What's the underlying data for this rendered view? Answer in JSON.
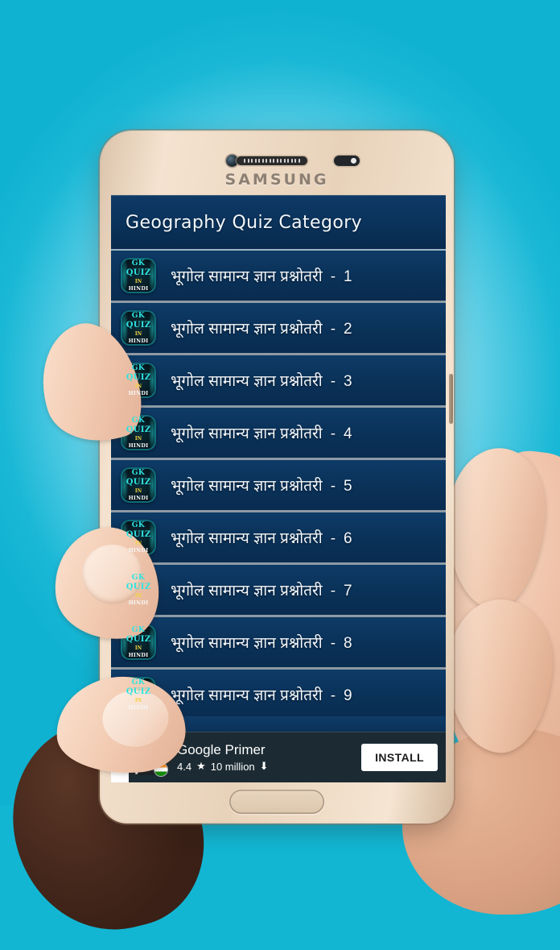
{
  "background": {
    "accent_cyan": "#12b6d3",
    "center_light": "#ddf7fb"
  },
  "device": {
    "brand": "SAMSUNG",
    "bezel_color": "#e8d2ba",
    "hardware": {
      "camera": "front-camera",
      "speaker": "earpiece-speaker",
      "sensor": "proximity-sensor",
      "power_button": "power-button",
      "home_button": "home-button"
    }
  },
  "app": {
    "appbar": {
      "title": "Geography Quiz Category",
      "background": "#0a3159",
      "text_color": "#f2f7fb"
    },
    "icon": {
      "line1": "GK",
      "line2": "QUIZ",
      "line3": "IN",
      "line4": "HINDI",
      "teal": "#2fe3e0",
      "yellow": "#f4d23c"
    },
    "list": {
      "row_background": "#0a3158",
      "separator_color": "#c7d0d7",
      "items": [
        {
          "label": "भूगोल सामान्य ज्ञान प्रश्नोतरी",
          "dash": "-",
          "number": "1"
        },
        {
          "label": "भूगोल सामान्य ज्ञान प्रश्नोतरी",
          "dash": "-",
          "number": "2"
        },
        {
          "label": "भूगोल सामान्य ज्ञान प्रश्नोतरी",
          "dash": "-",
          "number": "3"
        },
        {
          "label": "भूगोल सामान्य ज्ञान प्रश्नोतरी",
          "dash": "-",
          "number": "4"
        },
        {
          "label": "भूगोल सामान्य ज्ञान प्रश्नोतरी",
          "dash": "-",
          "number": "5"
        },
        {
          "label": "भूगोल सामान्य ज्ञान प्रश्नोतरी",
          "dash": "-",
          "number": "6"
        },
        {
          "label": "भूगोल सामान्य ज्ञान प्रश्नोतरी",
          "dash": "-",
          "number": "7"
        },
        {
          "label": "भूगोल सामान्य ज्ञान प्रश्नोतरी",
          "dash": "-",
          "number": "8"
        },
        {
          "label": "भूगोल सामान्य ज्ञान प्रश्नोतरी",
          "dash": "-",
          "number": "9"
        }
      ]
    }
  },
  "ad": {
    "info_icon": "ⓘ",
    "close_icon": "✕",
    "app_icon": "google-primer-flag-icon",
    "country_badge": "india-flag",
    "title": "Google Primer",
    "rating": "4.4",
    "star_icon": "★",
    "downloads": "10 million",
    "download_icon": "⬇",
    "install_label": "INSTALL",
    "background": "#1c2b33"
  }
}
